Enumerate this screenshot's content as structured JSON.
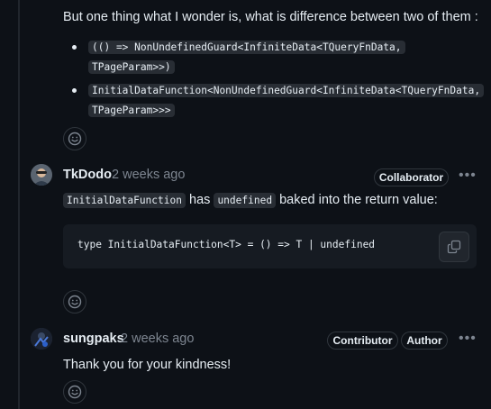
{
  "comment1": {
    "intro": "But one thing what I wonder is, what is difference between two of them :",
    "bullets": [
      {
        "line1": "(() => NonUndefinedGuard<InfiniteData<TQueryFnData,",
        "line2": "TPageParam>>)"
      },
      {
        "line1": "InitialDataFunction<NonUndefinedGuard<InfiniteData<TQueryFnData,",
        "line2": "TPageParam>>>"
      }
    ],
    "reaction_icon": "smiley-icon"
  },
  "comment2": {
    "author": "TkDodo",
    "time": "2 weeks ago",
    "badge": "Collaborator",
    "more_icon": "kebab-horizontal-icon",
    "text_code1": "InitialDataFunction",
    "text_mid": "has",
    "text_code2": "undefined",
    "text_end": "baked into the return value:",
    "code": "type InitialDataFunction<T> = () => T | undefined",
    "copy_icon": "copy-icon",
    "reaction_icon": "smiley-icon"
  },
  "comment3": {
    "author": "sungpaks",
    "time": "2 weeks ago",
    "badges": [
      "Contributor",
      "Author"
    ],
    "more_icon": "kebab-horizontal-icon",
    "text": "Thank you for your kindness!",
    "reaction_icon": "smiley-icon"
  }
}
